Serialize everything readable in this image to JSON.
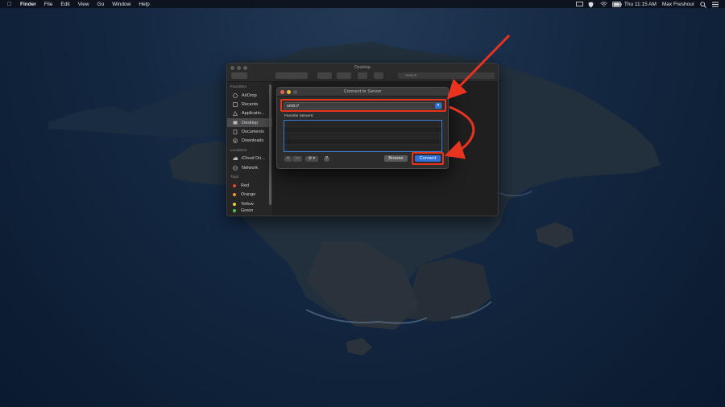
{
  "menubar": {
    "app_name": "Finder",
    "items": [
      "File",
      "Edit",
      "View",
      "Go",
      "Window",
      "Help"
    ],
    "clock": "Thu 11:15 AM",
    "user": "Max Freshour"
  },
  "finder": {
    "title": "Desktop",
    "search_placeholder": "Search",
    "sidebar": {
      "favorites_header": "Favorites",
      "favorites": [
        {
          "label": "AirDrop",
          "icon": "airdrop-icon"
        },
        {
          "label": "Recents",
          "icon": "clock-icon"
        },
        {
          "label": "Applicatio...",
          "icon": "applications-icon"
        },
        {
          "label": "Desktop",
          "icon": "desktop-icon"
        },
        {
          "label": "Documents",
          "icon": "document-icon"
        },
        {
          "label": "Downloads",
          "icon": "download-icon"
        }
      ],
      "locations_header": "Locations",
      "locations": [
        {
          "label": "iCloud Dri...",
          "icon": "cloud-icon"
        },
        {
          "label": "Network",
          "icon": "network-icon"
        }
      ],
      "tags_header": "Tags",
      "tags": [
        {
          "label": "Red",
          "color": "#e8443a"
        },
        {
          "label": "Orange",
          "color": "#f0962e"
        },
        {
          "label": "Yellow",
          "color": "#f2cf2d"
        },
        {
          "label": "Green",
          "color": "#4fc24a"
        }
      ]
    }
  },
  "dialog": {
    "title": "Connect to Server",
    "address_value": "smb://",
    "favorites_label": "Favorite Servers:",
    "add_label": "+",
    "remove_label": "—",
    "gear_label": "⚙ ▾",
    "help_label": "?",
    "browse_label": "Browse",
    "connect_label": "Connect"
  },
  "colors": {
    "accent": "#2f6fd6",
    "annotation": "#e8331f"
  }
}
